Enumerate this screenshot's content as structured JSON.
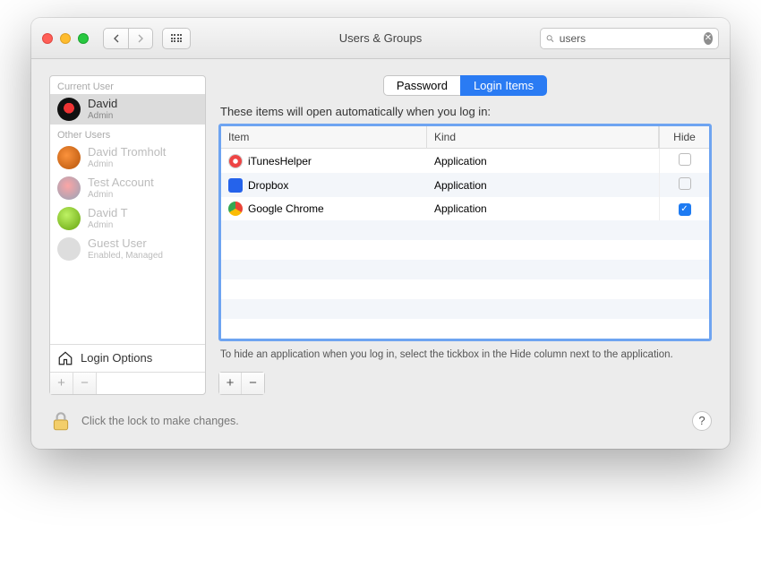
{
  "window": {
    "title": "Users & Groups",
    "search_value": "users"
  },
  "sidebar": {
    "current_header": "Current User",
    "other_header": "Other Users",
    "current": {
      "name": "David",
      "role": "Admin"
    },
    "others": [
      {
        "name": "David Tromholt",
        "role": "Admin"
      },
      {
        "name": "Test Account",
        "role": "Admin"
      },
      {
        "name": "David T",
        "role": "Admin"
      },
      {
        "name": "Guest User",
        "role": "Enabled, Managed"
      }
    ],
    "login_options": "Login Options"
  },
  "tabs": {
    "password": "Password",
    "login_items": "Login Items"
  },
  "main": {
    "subtitle": "These items will open automatically when you log in:",
    "headers": {
      "item": "Item",
      "kind": "Kind",
      "hide": "Hide"
    },
    "rows": [
      {
        "name": "iTunesHelper",
        "kind": "Application",
        "hide": false,
        "icon": "itunes"
      },
      {
        "name": "Dropbox",
        "kind": "Application",
        "hide": false,
        "icon": "dropbox"
      },
      {
        "name": "Google Chrome",
        "kind": "Application",
        "hide": true,
        "icon": "chrome"
      }
    ],
    "hint": "To hide an application when you log in, select the tickbox in the Hide column next to the application."
  },
  "lock": {
    "text": "Click the lock to make changes.",
    "help": "?"
  },
  "icon_colors": {
    "itunes": "#e44",
    "dropbox": "#2563eb",
    "chrome": "#22c55e"
  }
}
